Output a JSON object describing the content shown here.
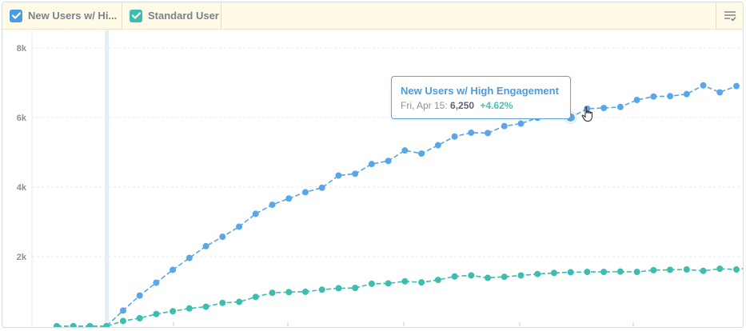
{
  "legend": {
    "items": [
      {
        "label": "New Users w/ Hi...",
        "color": "#4a9be0",
        "checked": true
      },
      {
        "label": "Standard User",
        "color": "#3dbcb0",
        "checked": true
      }
    ],
    "menu_icon": "filter-list-icon"
  },
  "tooltip": {
    "title": "New Users w/ High Engagement",
    "date": "Fri, Apr 15:",
    "value": "6,250",
    "change": "+4.62%"
  },
  "chart_data": {
    "type": "line",
    "y_tick_labels": [
      "2k",
      "4k",
      "6k",
      "8k"
    ],
    "y_ticks": [
      2000,
      4000,
      6000,
      8000
    ],
    "ylim": [
      0,
      8500
    ],
    "grid": true,
    "legend_placement": "top-left",
    "highlight": {
      "series": 0,
      "index": 31
    },
    "series": [
      {
        "name": "New Users w/ High Engagement",
        "color": "#5aa6e6",
        "values": [
          0,
          0,
          0,
          0,
          450,
          880,
          1250,
          1620,
          1960,
          2300,
          2570,
          2860,
          3230,
          3490,
          3670,
          3850,
          3980,
          4330,
          4380,
          4660,
          4750,
          5050,
          4960,
          5200,
          5450,
          5560,
          5550,
          5750,
          5820,
          5990,
          6140,
          6000,
          6250,
          6270,
          6300,
          6500,
          6600,
          6610,
          6670,
          6920,
          6720,
          6900
        ]
      },
      {
        "name": "Standard User",
        "color": "#3dbcb0",
        "values": [
          0,
          0,
          0,
          0,
          150,
          230,
          350,
          430,
          510,
          560,
          670,
          700,
          840,
          960,
          980,
          990,
          1050,
          1090,
          1100,
          1220,
          1230,
          1290,
          1260,
          1330,
          1430,
          1460,
          1390,
          1420,
          1460,
          1500,
          1530,
          1550,
          1560,
          1560,
          1570,
          1560,
          1610,
          1620,
          1630,
          1590,
          1650,
          1630,
          1700
        ]
      }
    ]
  }
}
